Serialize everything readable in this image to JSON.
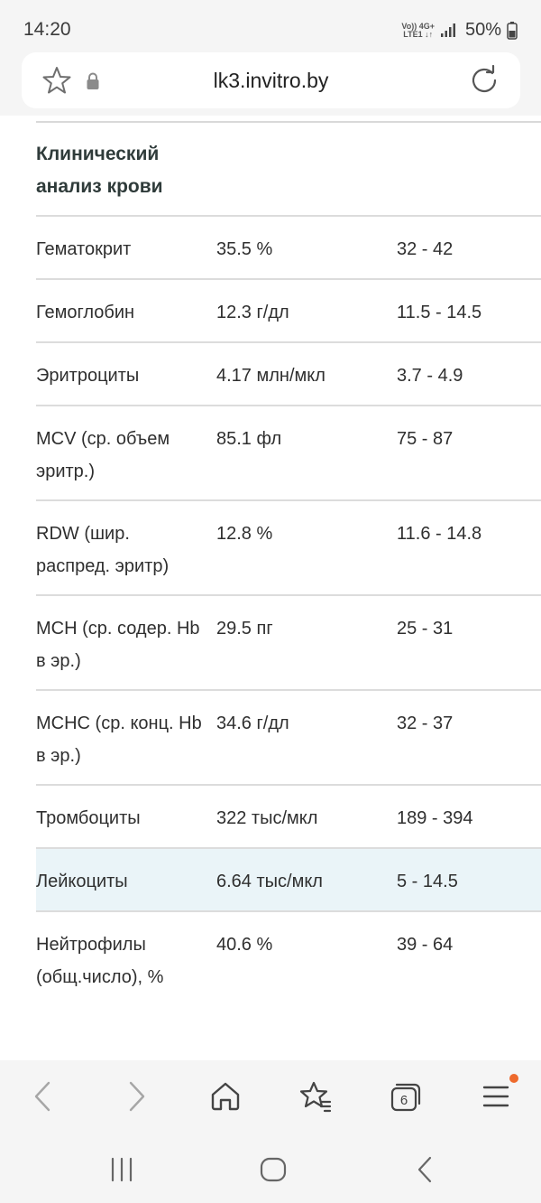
{
  "status_bar": {
    "time": "14:20",
    "signal_text_top": "Vo)) 4G+",
    "signal_text_bottom": "LTE1 ↓↑",
    "battery": "50%"
  },
  "address_bar": {
    "url": "lk3.invitro.by"
  },
  "section": {
    "title": "Клинический\nанализ крови"
  },
  "rows": [
    {
      "name": "Гематокрит",
      "value": "35.5 %",
      "ref": "32 - 42",
      "lines": 1
    },
    {
      "name": "Гемоглобин",
      "value": "12.3 г/дл",
      "ref": "11.5 - 14.5",
      "lines": 1
    },
    {
      "name": "Эритроциты",
      "value": "4.17 млн/мкл",
      "ref": "3.7 - 4.9",
      "lines": 1
    },
    {
      "name": "MCV (ср. объем\nэритр.)",
      "value": "85.1 фл",
      "ref": "75 - 87",
      "lines": 2
    },
    {
      "name": "RDW (шир.\nраспред. эритр)",
      "value": "12.8 %",
      "ref": "11.6 - 14.8",
      "lines": 2
    },
    {
      "name": "MCH (ср. содер. Hb\nв эр.)",
      "value": "29.5 пг",
      "ref": "25 - 31",
      "lines": 2
    },
    {
      "name": "MCHC (ср. конц. Hb\nв эр.)",
      "value": "34.6 г/дл",
      "ref": "32 - 37",
      "lines": 2
    },
    {
      "name": "Тромбоциты",
      "value": "322 тыс/мкл",
      "ref": "189 - 394",
      "lines": 1
    },
    {
      "name": "Лейкоциты",
      "value": "6.64 тыс/мкл",
      "ref": "5 - 14.5",
      "lines": 1,
      "highlight": true
    },
    {
      "name": "Нейтрофилы\n(общ.число), %",
      "value": "40.6 %",
      "ref": "39 - 64",
      "lines": 2
    }
  ],
  "toolbar": {
    "tabs_count": "6"
  },
  "icons": {
    "star": "star-icon",
    "lock": "lock-icon",
    "reload": "reload-icon",
    "back": "chevron-left-icon",
    "forward": "chevron-right-icon",
    "home": "home-icon",
    "bookmarks": "bookmarks-icon",
    "tabs": "tabs-icon",
    "menu": "menu-icon"
  },
  "colors": {
    "highlight_row": "#eaf4f8",
    "menu_badge": "#ee6a2c"
  }
}
